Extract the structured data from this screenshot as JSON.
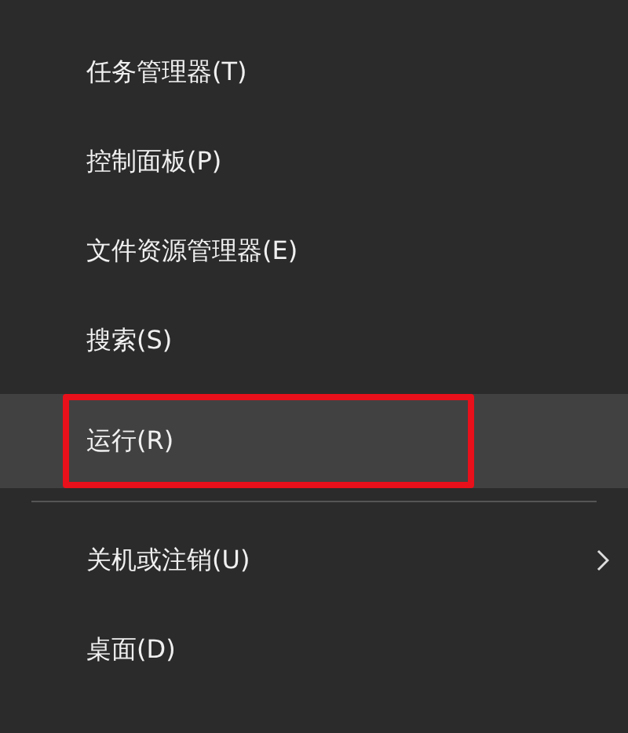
{
  "menu": {
    "items": [
      {
        "kind": "item",
        "label": "任务管理器(T)",
        "hovered": false,
        "highlighted": false
      },
      {
        "kind": "item",
        "label": "控制面板(P)",
        "hovered": false,
        "highlighted": false
      },
      {
        "kind": "item",
        "label": "文件资源管理器(E)",
        "hovered": false,
        "highlighted": false
      },
      {
        "kind": "item",
        "label": "搜索(S)",
        "hovered": false,
        "highlighted": false
      },
      {
        "kind": "item",
        "label": "运行(R)",
        "hovered": true,
        "highlighted": true
      },
      {
        "kind": "separator"
      },
      {
        "kind": "submenu",
        "label": "关机或注销(U)",
        "hovered": false,
        "highlighted": false
      },
      {
        "kind": "item",
        "label": "桌面(D)",
        "hovered": false,
        "highlighted": false
      }
    ]
  }
}
